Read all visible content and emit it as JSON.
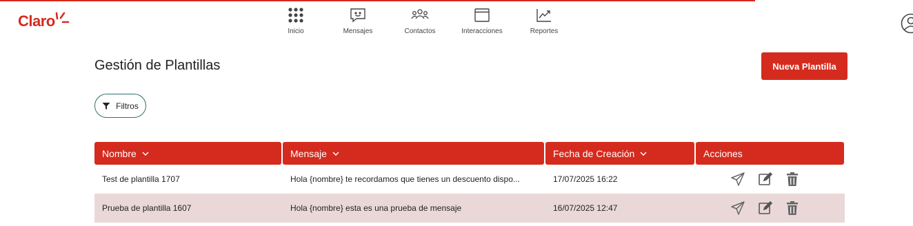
{
  "brand": {
    "logo_text": "Claro"
  },
  "nav": [
    {
      "label": "Inicio",
      "icon": "grid-icon"
    },
    {
      "label": "Mensajes",
      "icon": "chat-icon"
    },
    {
      "label": "Contactos",
      "icon": "people-icon"
    },
    {
      "label": "Interacciones",
      "icon": "window-icon"
    },
    {
      "label": "Reportes",
      "icon": "chart-trend-icon"
    }
  ],
  "page": {
    "title": "Gestión de Plantillas",
    "new_button": "Nueva Plantilla",
    "filter_button": "Filtros"
  },
  "table": {
    "columns": [
      "Nombre",
      "Mensaje",
      "Fecha de Creación",
      "Acciones"
    ],
    "rows": [
      {
        "nombre": "Test de plantilla 1707",
        "mensaje": "Hola {nombre} te recordamos que tienes un descuento dispo...",
        "fecha": "17/07/2025 16:22"
      },
      {
        "nombre": "Prueba de plantilla 1607",
        "mensaje": "Hola {nombre} esta es una prueba de mensaje",
        "fecha": "16/07/2025 12:47"
      }
    ],
    "row_actions": [
      "send-icon",
      "edit-icon",
      "trash-icon"
    ]
  },
  "colors": {
    "brand_red": "#d52b1e",
    "row_alt": "#ead8d8",
    "filter_border": "#2f6f6f"
  }
}
